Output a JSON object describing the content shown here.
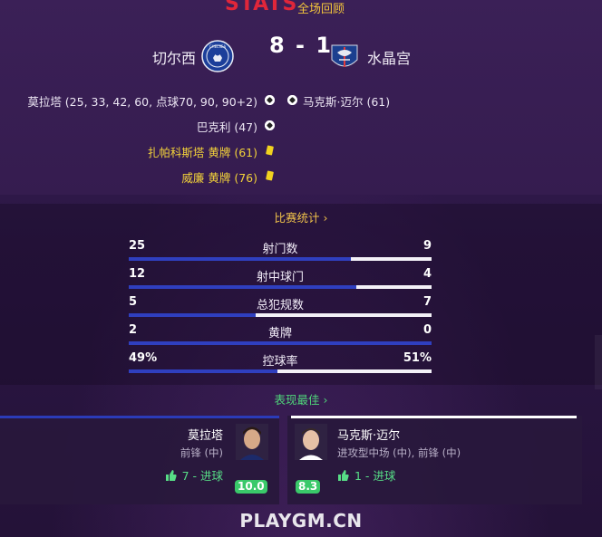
{
  "header": {
    "logo_text": "STATS",
    "recap_label": "全场回顾"
  },
  "match": {
    "home_team": "切尔西",
    "away_team": "水晶宫",
    "score": "8 - 1",
    "home_crest_text": "CHELSEA"
  },
  "events": {
    "home": [
      {
        "text": "莫拉塔 (25, 33, 42, 60, 点球70, 90, 90+2)",
        "icon": "goal-ball-icon"
      },
      {
        "text": "巴克利 (47)",
        "icon": "goal-ball-icon"
      },
      {
        "text": "扎帕科斯塔 黄牌 (61)",
        "icon": "yellow-card-icon"
      },
      {
        "text": "威廉 黄牌 (76)",
        "icon": "yellow-card-icon"
      }
    ],
    "away": [
      {
        "text": "马克斯·迈尔 (61)",
        "icon": "goal-ball-icon"
      }
    ]
  },
  "stats": {
    "header_label": "比赛统计 ›",
    "rows": [
      {
        "label": "射门数",
        "home": "25",
        "away": "9",
        "home_share": 0.735
      },
      {
        "label": "射中球门",
        "home": "12",
        "away": "4",
        "home_share": 0.75
      },
      {
        "label": "总犯规数",
        "home": "5",
        "away": "7",
        "home_share": 0.42
      },
      {
        "label": "黄牌",
        "home": "2",
        "away": "0",
        "home_share": 1.0
      },
      {
        "label": "控球率",
        "home": "49%",
        "away": "51%",
        "home_share": 0.49
      }
    ]
  },
  "best": {
    "header_label": "表现最佳 ›",
    "home_player": {
      "name": "莫拉塔",
      "position": "前锋 (中)",
      "goals": "7 - 进球",
      "rating": "10.0"
    },
    "away_player": {
      "name": "马克斯·迈尔",
      "position": "进攻型中场 (中), 前锋 (中)",
      "goals": "1 - 进球",
      "rating": "8.3"
    }
  },
  "watermark": "PLAYGM.CN",
  "colors": {
    "home_bar": "#2f3fbf",
    "away_bar": "#f3f1f7",
    "gold_link": "#f3c53b",
    "green_link": "#4fd67a",
    "yellow_card": "#f1d21f",
    "rating_badge": "#3ac96a"
  }
}
